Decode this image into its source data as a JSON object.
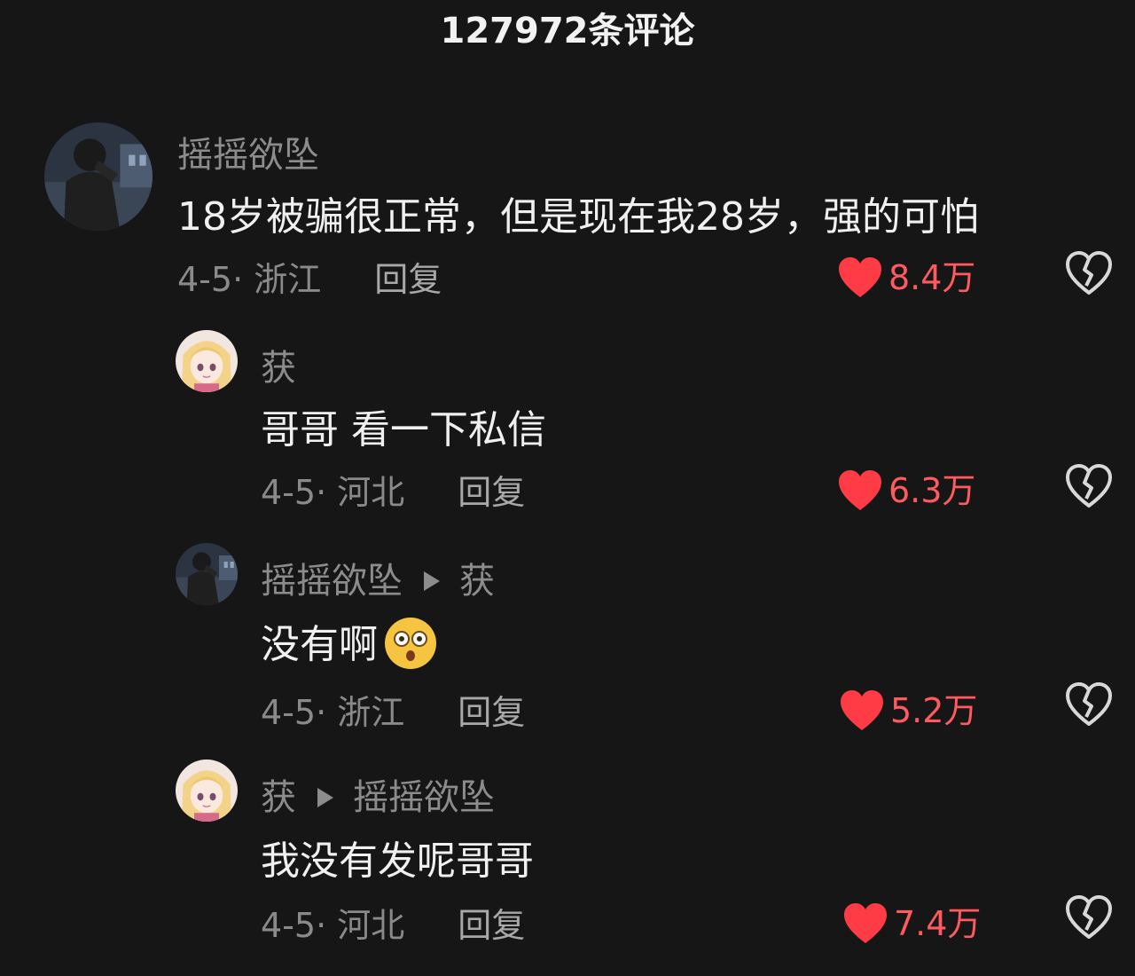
{
  "header": {
    "title": "127972条评论"
  },
  "comments": [
    {
      "username": "摇摇欲坠",
      "reply_to": "",
      "text": "18岁被骗很正常，但是现在我28岁，强的可怕",
      "date_location": "4-5· 浙江",
      "reply_label": "回复",
      "likes": "8.4万",
      "avatar_icon": "avatar-dark-photo"
    },
    {
      "username": "获",
      "reply_to": "",
      "text": "哥哥 看一下私信",
      "date_location": "4-5· 河北",
      "reply_label": "回复",
      "likes": "6.3万",
      "avatar_icon": "avatar-anime-girl"
    },
    {
      "username": "摇摇欲坠",
      "reply_to": "获",
      "text": "没有啊",
      "emoji": "shocked-face-emoji",
      "date_location": "4-5· 浙江",
      "reply_label": "回复",
      "likes": "5.2万",
      "avatar_icon": "avatar-dark-photo"
    },
    {
      "username": "获",
      "reply_to": "摇摇欲坠",
      "text": "我没有发呢哥哥",
      "date_location": "4-5· 河北",
      "reply_label": "回复",
      "likes": "7.4万",
      "avatar_icon": "avatar-anime-girl"
    }
  ],
  "colors": {
    "background": "#161616",
    "like_red": "#ff5a5f",
    "username_gray": "#8c8c8c",
    "text_white": "#f0f0f0"
  }
}
